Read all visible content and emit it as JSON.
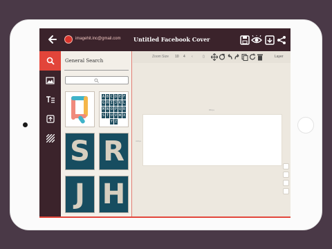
{
  "header": {
    "account_email": "imagehit.inc@gmail.com",
    "title": "Untitled Facebook Cover",
    "icons": [
      "back-arrow-icon",
      "avatar-icon",
      "save-icon",
      "preview-eye-icon",
      "download-icon",
      "share-icon"
    ]
  },
  "rail": {
    "items": [
      {
        "name": "search",
        "icon": "search-icon",
        "active": true
      },
      {
        "name": "photos",
        "icon": "photo-icon",
        "active": false
      },
      {
        "name": "text",
        "icon": "text-icon",
        "active": false
      },
      {
        "name": "upload",
        "icon": "upload-icon",
        "active": false
      },
      {
        "name": "background",
        "icon": "stripes-icon",
        "active": false
      }
    ]
  },
  "panel": {
    "title": "General Search",
    "search_placeholder": "",
    "thumbnails": [
      {
        "type": "letter",
        "letter": "Q"
      },
      {
        "type": "alphabet",
        "letters": [
          "A",
          "B",
          "C",
          "D",
          "E",
          "F",
          "G",
          "H",
          "I",
          "J",
          "K",
          "L",
          "M",
          "N",
          "O",
          "P",
          "Q",
          "R",
          "S",
          "T",
          "U",
          "V",
          "W",
          "X",
          "Y",
          "Z"
        ]
      },
      {
        "type": "tile",
        "letters": "S"
      },
      {
        "type": "tile",
        "letters": "R"
      },
      {
        "type": "tile",
        "letters": "J"
      },
      {
        "type": "tile",
        "letters": "H"
      }
    ]
  },
  "toolbar": {
    "zoom_label": "Zoom Size",
    "zoom_value": "10",
    "step_value": "4",
    "layer_label": "Layer"
  },
  "canvas": {
    "top_ruler_label": "850px",
    "left_ruler_label": "315px"
  },
  "colors": {
    "brand_dark": "#3b232b",
    "accent": "#e2453a",
    "tile": "#174d60"
  }
}
